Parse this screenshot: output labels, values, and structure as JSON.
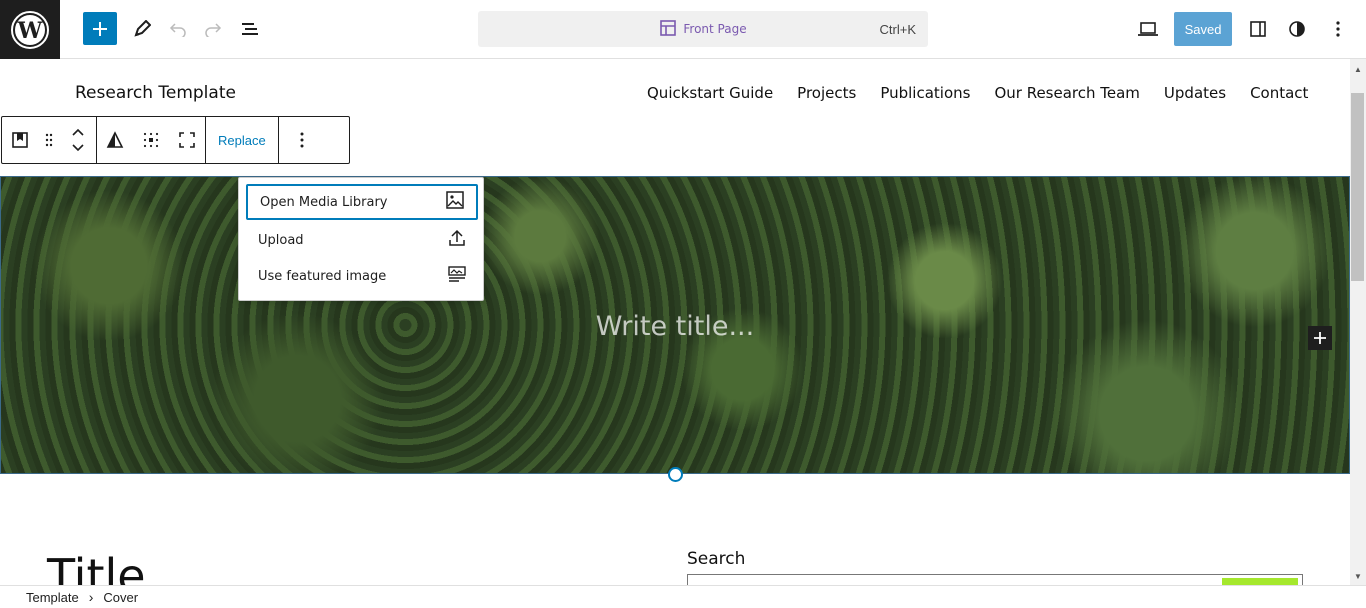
{
  "header": {
    "document_title": "Front Page",
    "shortcut": "Ctrl+K",
    "save_label": "Saved"
  },
  "site": {
    "title": "Research Template",
    "nav": [
      "Quickstart Guide",
      "Projects",
      "Publications",
      "Our Research Team",
      "Updates",
      "Contact"
    ]
  },
  "block_toolbar": {
    "replace_label": "Replace"
  },
  "replace_menu": {
    "items": [
      {
        "label": "Open Media Library",
        "icon": "image-icon"
      },
      {
        "label": "Upload",
        "icon": "upload-icon"
      },
      {
        "label": "Use featured image",
        "icon": "featured-image-icon"
      }
    ]
  },
  "cover": {
    "title_placeholder": "Write title..."
  },
  "content": {
    "page_title": "Title",
    "search_label": "Search"
  },
  "breadcrumb": {
    "items": [
      "Template",
      "Cover"
    ]
  },
  "colors": {
    "accent": "#007cba",
    "toolbar_dark": "#1e1e1e",
    "search_button": "#a5e82d"
  }
}
